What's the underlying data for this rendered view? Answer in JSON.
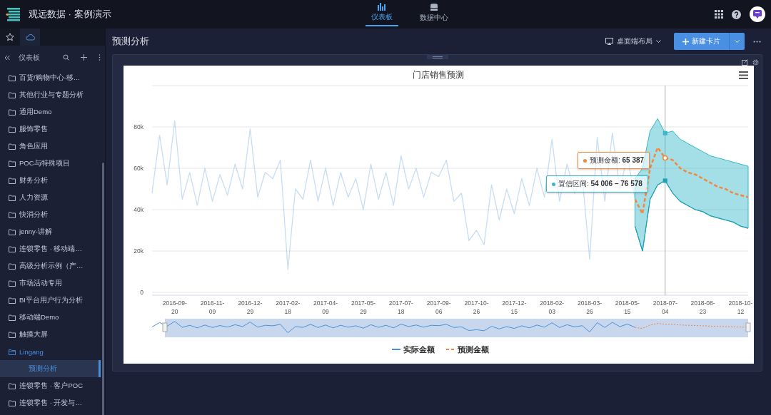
{
  "app": {
    "title": "观远数据 · 案例演示"
  },
  "nav_tabs": [
    {
      "label": "仪表板",
      "selected": true
    },
    {
      "label": "数据中心",
      "selected": false
    }
  ],
  "sidebar": {
    "tabs": [
      {
        "kind": "star",
        "selected": false
      },
      {
        "kind": "cloud",
        "selected": true
      }
    ],
    "title": "仪表板",
    "items": [
      {
        "label": "百货/购物中心-移…",
        "selected": false,
        "expanded": false
      },
      {
        "label": "其他行业与专题分析",
        "selected": false,
        "expanded": false
      },
      {
        "label": "通用Demo",
        "selected": false,
        "expanded": false
      },
      {
        "label": "服饰零售",
        "selected": false,
        "expanded": false
      },
      {
        "label": "角色应用",
        "selected": false,
        "expanded": false
      },
      {
        "label": "POC与特殊项目",
        "selected": false,
        "expanded": false
      },
      {
        "label": "财务分析",
        "selected": false,
        "expanded": false
      },
      {
        "label": "人力资源",
        "selected": false,
        "expanded": false
      },
      {
        "label": "快消分析",
        "selected": false,
        "expanded": false
      },
      {
        "label": "jenny-讲解",
        "selected": false,
        "expanded": false
      },
      {
        "label": "连锁零售 · 移动端…",
        "selected": false,
        "expanded": false
      },
      {
        "label": "高级分析示例（产…",
        "selected": false,
        "expanded": false
      },
      {
        "label": "市场活动专用",
        "selected": false,
        "expanded": false
      },
      {
        "label": "BI平台用户行为分析",
        "selected": false,
        "expanded": false
      },
      {
        "label": "移动端Demo",
        "selected": false,
        "expanded": false
      },
      {
        "label": "触摸大屏",
        "selected": false,
        "expanded": false
      },
      {
        "label": "Lingang",
        "selected": false,
        "expanded": true,
        "children": [
          {
            "label": "预测分析",
            "selected": true
          }
        ]
      },
      {
        "label": "连锁零售 · 客户POC",
        "selected": false,
        "expanded": false
      },
      {
        "label": "连锁零售 · 开发与…",
        "selected": false,
        "expanded": false
      }
    ]
  },
  "page": {
    "title": "预测分析",
    "layout_menu": "桌面端布局",
    "new_button": "新建卡片"
  },
  "card": {
    "chart_data": {
      "type": "line",
      "title": "门店销售预测",
      "categories": [
        null,
        null,
        null,
        "2016-09-20",
        null,
        null,
        null,
        null,
        "2016-11-09",
        null,
        null,
        null,
        null,
        "2016-12-29",
        null,
        null,
        null,
        null,
        "2017-02-18",
        null,
        null,
        null,
        null,
        "2017-04-09",
        null,
        null,
        null,
        null,
        "2017-05-29",
        null,
        null,
        null,
        null,
        "2017-07-18",
        null,
        null,
        null,
        null,
        "2017-09-06",
        null,
        null,
        null,
        null,
        "2017-10-26",
        null,
        null,
        null,
        null,
        "2017-12-15",
        null,
        null,
        null,
        null,
        "2018-02-03",
        null,
        null,
        null,
        null,
        "2018-03-26",
        null,
        null,
        null,
        null,
        "2018-05-15",
        null,
        null,
        null,
        null,
        "2018-07-04",
        null,
        null,
        null,
        null,
        "2018-08-23",
        null,
        null,
        null,
        null,
        "2018-10-12",
        null
      ],
      "ylim": [
        0,
        100000
      ],
      "yticks": [
        {
          "value": 0,
          "label": "0"
        },
        {
          "value": 20000,
          "label": "20k"
        },
        {
          "value": 40000,
          "label": "40k"
        },
        {
          "value": 60000,
          "label": "60k"
        },
        {
          "value": 80000,
          "label": "80k"
        }
      ],
      "series": [
        {
          "name": "实际金额",
          "color": "#4a90d9",
          "line_style": "solid",
          "values": [
            48000,
            76000,
            52000,
            83000,
            45000,
            58000,
            42000,
            60000,
            44000,
            57000,
            47000,
            62000,
            50000,
            79000,
            46000,
            58000,
            55000,
            64000,
            11000,
            50000,
            45000,
            64000,
            44000,
            60000,
            42000,
            58000,
            46000,
            55000,
            40000,
            62000,
            45000,
            58000,
            42000,
            66000,
            50000,
            60000,
            46000,
            58000,
            56000,
            64000,
            44000,
            48000,
            25000,
            30000,
            23000,
            52000,
            35000,
            50000,
            38000,
            55000,
            42000,
            60000,
            46000,
            74000,
            44000,
            62000,
            48000,
            56000,
            16000,
            75000,
            44000,
            77000,
            50000,
            66000,
            45000,
            null,
            null,
            null,
            null,
            null,
            null,
            null,
            null,
            null,
            null,
            null,
            null,
            null,
            null,
            null
          ]
        },
        {
          "name": "预测金额",
          "color": "#f0883e",
          "line_style": "dashed",
          "values": [
            null,
            null,
            null,
            null,
            null,
            null,
            null,
            null,
            null,
            null,
            null,
            null,
            null,
            null,
            null,
            null,
            null,
            null,
            null,
            null,
            null,
            null,
            null,
            null,
            null,
            null,
            null,
            null,
            null,
            null,
            null,
            null,
            null,
            null,
            null,
            null,
            null,
            null,
            null,
            null,
            null,
            null,
            null,
            null,
            null,
            null,
            null,
            null,
            null,
            null,
            null,
            null,
            null,
            null,
            null,
            null,
            null,
            null,
            null,
            null,
            null,
            null,
            null,
            null,
            45000,
            38000,
            60000,
            70000,
            65000,
            64000,
            60000,
            58000,
            57000,
            55000,
            53000,
            51000,
            50000,
            48000,
            47000,
            46000
          ]
        },
        {
          "name": "置信区间",
          "color": "#36b8c9",
          "type": "area",
          "values": [
            null,
            null,
            null,
            null,
            null,
            null,
            null,
            null,
            null,
            null,
            null,
            null,
            null,
            null,
            null,
            null,
            null,
            null,
            null,
            null,
            null,
            null,
            null,
            null,
            null,
            null,
            null,
            null,
            null,
            null,
            null,
            null,
            null,
            null,
            null,
            null,
            null,
            null,
            null,
            null,
            null,
            null,
            null,
            null,
            null,
            null,
            null,
            null,
            null,
            null,
            null,
            null,
            null,
            null,
            null,
            null,
            null,
            null,
            null,
            null,
            null,
            null,
            null,
            null,
            55000,
            60000,
            78000,
            84000,
            77000,
            78000,
            74000,
            72000,
            70000,
            68000,
            66000,
            65000,
            64000,
            63000,
            62000,
            61000
          ]
        },
        {
          "color": "#1f9fb3",
          "values": [
            null,
            null,
            null,
            null,
            null,
            null,
            null,
            null,
            null,
            null,
            null,
            null,
            null,
            null,
            null,
            null,
            null,
            null,
            null,
            null,
            null,
            null,
            null,
            null,
            null,
            null,
            null,
            null,
            null,
            null,
            null,
            null,
            null,
            null,
            null,
            null,
            null,
            null,
            null,
            null,
            null,
            null,
            null,
            null,
            null,
            null,
            null,
            null,
            null,
            null,
            null,
            null,
            null,
            null,
            null,
            null,
            null,
            null,
            null,
            null,
            null,
            null,
            null,
            null,
            32000,
            20000,
            45000,
            52000,
            54000,
            48000,
            44000,
            42000,
            40000,
            39000,
            37000,
            36000,
            35000,
            34000,
            32000,
            31000
          ]
        }
      ],
      "grid": true,
      "legend": "bottom"
    },
    "tooltips": [
      {
        "value": ": **65 387**"
      },
      {
        "value": ": **54 006 – 76 578**"
      }
    ]
  }
}
